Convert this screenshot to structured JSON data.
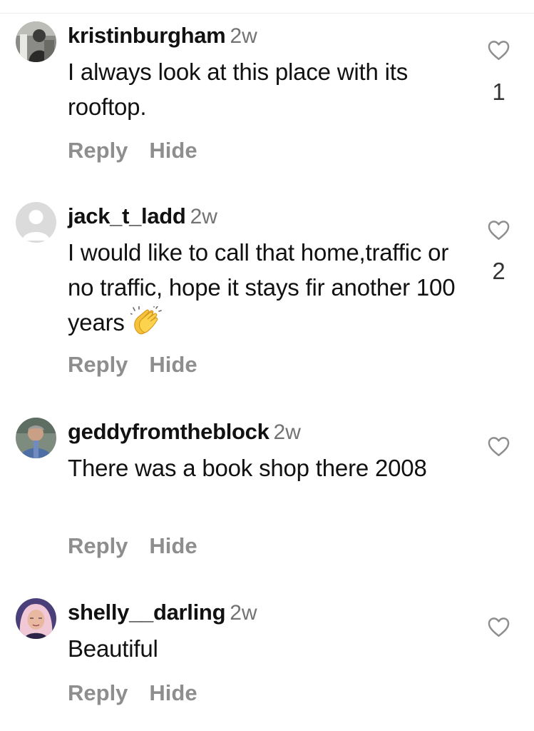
{
  "comments": [
    {
      "username": "kristinburgham",
      "time": "2w",
      "text": "I always look at this place with its rooftop.",
      "reply_label": "Reply",
      "hide_label": "Hide",
      "like_count": "1",
      "like_icon": "heart-outline-icon"
    },
    {
      "username": "jack_t_ladd",
      "time": "2w",
      "text": "I would like to call that home,traffic or no traffic, hope it stays fir another 100 years",
      "emoji": "clapping-hands-emoji",
      "reply_label": "Reply",
      "hide_label": "Hide",
      "like_count": "2",
      "like_icon": "heart-outline-icon"
    },
    {
      "username": "geddyfromtheblock",
      "time": "2w",
      "text": "There was a book shop there 2008",
      "reply_label": "Reply",
      "hide_label": "Hide",
      "like_icon": "heart-outline-icon"
    },
    {
      "username": "shelly__darling",
      "time": "2w",
      "text": "Beautiful",
      "reply_label": "Reply",
      "hide_label": "Hide",
      "like_icon": "heart-outline-icon"
    }
  ],
  "colors": {
    "text": "#111111",
    "secondary": "#737373",
    "action": "#8e8e8e",
    "divider": "#ececec",
    "background": "#ffffff"
  }
}
